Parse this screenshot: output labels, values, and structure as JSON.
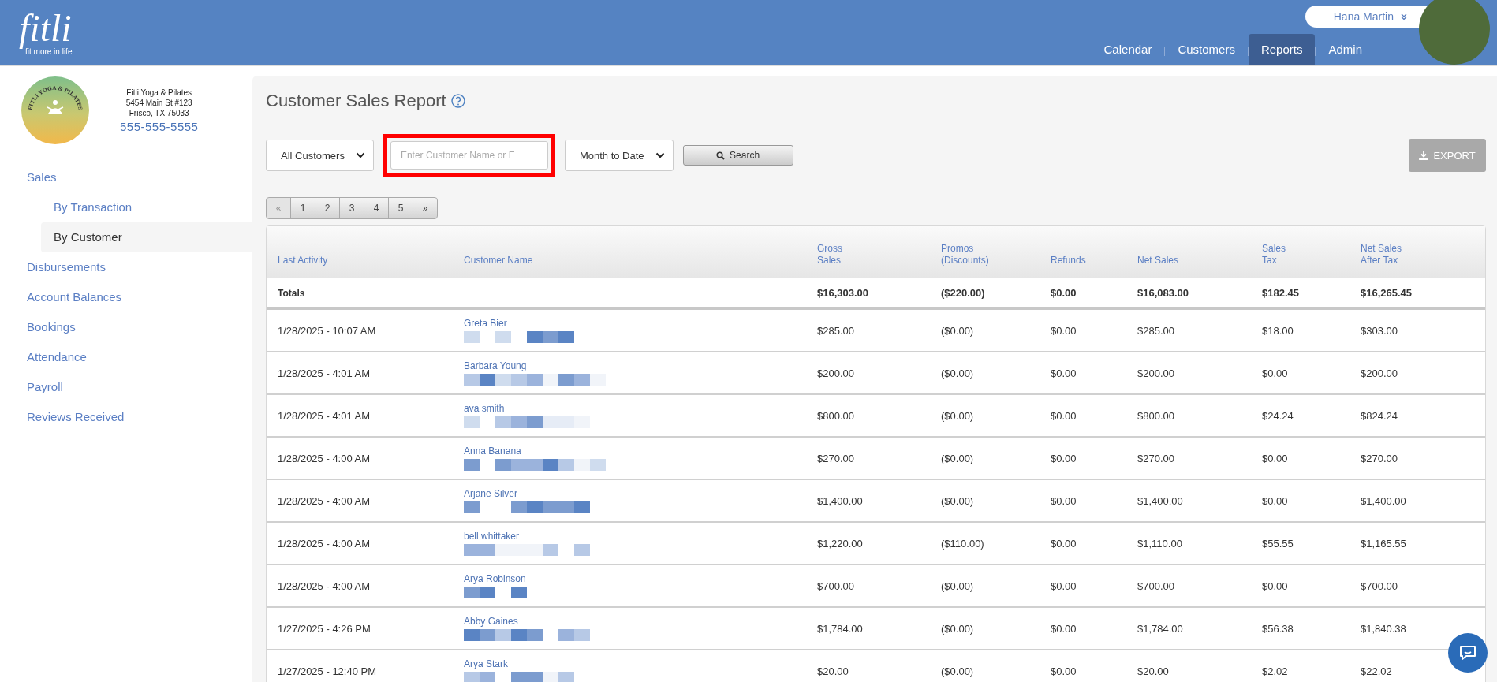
{
  "brand": {
    "logo": "fitli",
    "tagline": "fit more in life"
  },
  "user": {
    "name": "Hana Martin"
  },
  "nav": [
    {
      "label": "Calendar",
      "selected": false
    },
    {
      "label": "Customers",
      "selected": false
    },
    {
      "label": "Reports",
      "selected": true
    },
    {
      "label": "Admin",
      "selected": false
    }
  ],
  "studio": {
    "logo_text": "FITLI YOGA & PILATES",
    "name": "Fitli Yoga & Pilates",
    "address_1": "5454 Main St #123",
    "address_2": "Frisco, TX 75033",
    "phone": "555-555-5555"
  },
  "sidebar": {
    "items": [
      {
        "label": "Sales",
        "selected": false,
        "children": [
          {
            "label": "By Transaction",
            "selected": false
          },
          {
            "label": "By Customer",
            "selected": true
          }
        ]
      },
      {
        "label": "Disbursements",
        "selected": false
      },
      {
        "label": "Account Balances",
        "selected": false
      },
      {
        "label": "Bookings",
        "selected": false
      },
      {
        "label": "Attendance",
        "selected": false
      },
      {
        "label": "Payroll",
        "selected": false
      },
      {
        "label": "Reviews Received",
        "selected": false
      }
    ]
  },
  "page": {
    "title": "Customer Sales Report"
  },
  "filters": {
    "customer_select": "All Customers",
    "search": {
      "placeholder": "Enter Customer Name or E",
      "highlighted": true
    },
    "period_select": "Month to Date",
    "search_button": "Search",
    "export_button": "EXPORT",
    "export_disabled": true
  },
  "pagination": {
    "first": "«",
    "last": "»",
    "pages": [
      {
        "label": "1",
        "selected": false
      },
      {
        "label": "2",
        "selected": false
      },
      {
        "label": "3",
        "selected": false
      },
      {
        "label": "4",
        "selected": false
      },
      {
        "label": "5",
        "selected": false
      }
    ]
  },
  "table": {
    "columns": [
      "Last Activity",
      "Customer Name",
      "Gross\nSales",
      "Promos\n(Discounts)",
      "Refunds",
      "Net Sales",
      "Sales\nTax",
      "Net Sales\nAfter Tax"
    ],
    "totals": {
      "label": "Totals",
      "values": [
        "$16,303.00",
        "($220.00)",
        "$0.00",
        "$16,083.00",
        "$182.45",
        "$16,265.45"
      ]
    },
    "rows": [
      [
        "1/28/2025 - 10:07 AM",
        "Greta Bier",
        "$285.00",
        "($0.00)",
        "$0.00",
        "$285.00",
        "$18.00",
        "$303.00"
      ],
      [
        "1/28/2025 - 4:01 AM",
        "Barbara Young",
        "$200.00",
        "($0.00)",
        "$0.00",
        "$200.00",
        "$0.00",
        "$200.00"
      ],
      [
        "1/28/2025 - 4:01 AM",
        "ava smith",
        "$800.00",
        "($0.00)",
        "$0.00",
        "$800.00",
        "$24.24",
        "$824.24"
      ],
      [
        "1/28/2025 - 4:00 AM",
        "Anna Banana",
        "$270.00",
        "($0.00)",
        "$0.00",
        "$270.00",
        "$0.00",
        "$270.00"
      ],
      [
        "1/28/2025 - 4:00 AM",
        "Arjane Silver",
        "$1,400.00",
        "($0.00)",
        "$0.00",
        "$1,400.00",
        "$0.00",
        "$1,400.00"
      ],
      [
        "1/28/2025 - 4:00 AM",
        "bell whittaker",
        "$1,220.00",
        "($110.00)",
        "$0.00",
        "$1,110.00",
        "$55.55",
        "$1,165.55"
      ],
      [
        "1/28/2025 - 4:00 AM",
        "Arya Robinson",
        "$700.00",
        "($0.00)",
        "$0.00",
        "$700.00",
        "$0.00",
        "$700.00"
      ],
      [
        "1/27/2025 - 4:26 PM",
        "Abby Gaines",
        "$1,784.00",
        "($0.00)",
        "$0.00",
        "$1,784.00",
        "$56.38",
        "$1,840.38"
      ],
      [
        "1/27/2025 - 12:40 PM",
        "Arya Stark",
        "$20.00",
        "($0.00)",
        "$0.00",
        "$20.00",
        "$2.02",
        "$22.02"
      ]
    ]
  }
}
